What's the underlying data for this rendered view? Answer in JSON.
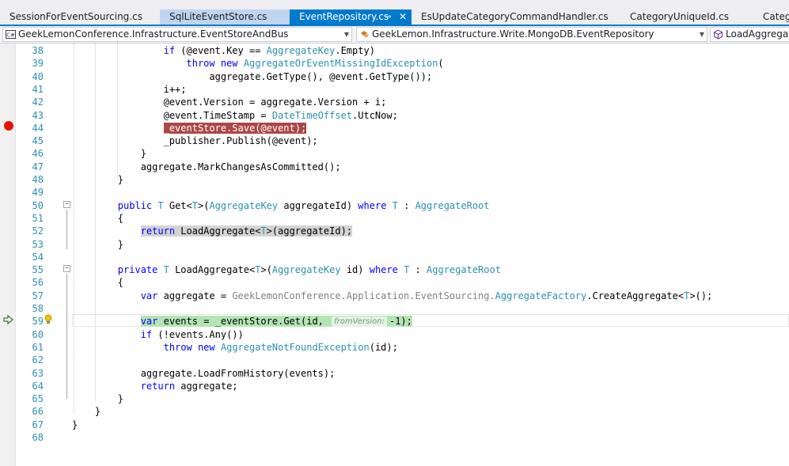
{
  "tabs": [
    {
      "label": "SessionForEventSourcing.cs",
      "state": "inactive"
    },
    {
      "label": "SqlLiteEventStore.cs",
      "state": "highlighted"
    },
    {
      "label": "EventRepository.cs",
      "state": "active",
      "pin": "⊸",
      "close": "✕"
    },
    {
      "label": "EsUpdateCategoryCommandHandler.cs",
      "state": "inactive"
    },
    {
      "label": "CategoryUniqueId.cs",
      "state": "inactive"
    },
    {
      "label": "Catego",
      "state": "inactive"
    }
  ],
  "navbar": {
    "project": "GeekLemonConference.Infrastructure.EventStoreAndBus",
    "class": "GeekLemon.Infrastructure.Write.MongoDB.EventRepository",
    "member": "LoadAggregate",
    "project_icon": "csharp-project-icon",
    "class_icon": "class-icon",
    "member_icon": "method-icon"
  },
  "editor": {
    "param_hint": "fromVersion:",
    "lines": [
      {
        "n": "38",
        "tokens": [
          [
            "                ",
            "plain"
          ],
          [
            "if",
            "kw"
          ],
          [
            " (@event.Key == ",
            "plain"
          ],
          [
            "AggregateKey",
            "type"
          ],
          [
            ".Empty)",
            "plain"
          ]
        ]
      },
      {
        "n": "39",
        "tokens": [
          [
            "                    ",
            "plain"
          ],
          [
            "throw",
            "kw"
          ],
          [
            " ",
            "plain"
          ],
          [
            "new",
            "kw"
          ],
          [
            " ",
            "plain"
          ],
          [
            "AggregateOrEventMissingIdException",
            "type"
          ],
          [
            "(",
            "plain"
          ]
        ]
      },
      {
        "n": "40",
        "tokens": [
          [
            "                        aggregate.GetType(), @event.GetType());",
            "plain"
          ]
        ]
      },
      {
        "n": "41",
        "tokens": [
          [
            "                i++;",
            "plain"
          ]
        ]
      },
      {
        "n": "42",
        "tokens": [
          [
            "                @event.Version = aggregate.Version + i;",
            "plain"
          ]
        ]
      },
      {
        "n": "43",
        "tokens": [
          [
            "                @event.TimeStamp = ",
            "plain"
          ],
          [
            "DateTimeOffset",
            "type"
          ],
          [
            ".UtcNow;",
            "plain"
          ]
        ]
      },
      {
        "n": "44",
        "tokens": [
          [
            "                ",
            "plain"
          ],
          [
            "_eventStore.Save(@event);",
            "bp"
          ]
        ]
      },
      {
        "n": "45",
        "tokens": [
          [
            "                _publisher.Publish(@event);",
            "plain"
          ]
        ]
      },
      {
        "n": "46",
        "tokens": [
          [
            "            }",
            "plain"
          ]
        ]
      },
      {
        "n": "47",
        "tokens": [
          [
            "            aggregate.MarkChangesAsCommitted();",
            "plain"
          ]
        ]
      },
      {
        "n": "48",
        "tokens": [
          [
            "        }",
            "plain"
          ]
        ]
      },
      {
        "n": "49",
        "tokens": []
      },
      {
        "n": "50",
        "tokens": [
          [
            "        ",
            "plain"
          ],
          [
            "public",
            "kw"
          ],
          [
            " ",
            "plain"
          ],
          [
            "T",
            "type"
          ],
          [
            " Get<",
            "plain"
          ],
          [
            "T",
            "type"
          ],
          [
            ">(",
            "plain"
          ],
          [
            "AggregateKey",
            "type"
          ],
          [
            " aggregateId) ",
            "plain"
          ],
          [
            "where",
            "kw"
          ],
          [
            " ",
            "plain"
          ],
          [
            "T",
            "type"
          ],
          [
            " : ",
            "plain"
          ],
          [
            "AggregateRoot",
            "type"
          ]
        ]
      },
      {
        "n": "51",
        "tokens": [
          [
            "        {",
            "plain"
          ]
        ]
      },
      {
        "n": "52",
        "tokens": [
          [
            "            ",
            "plain"
          ],
          [
            "return",
            "kw",
            "gray"
          ],
          [
            " LoadAggregate<",
            "plain",
            "gray"
          ],
          [
            "T",
            "type",
            "gray"
          ],
          [
            ">(aggregateId);",
            "plain",
            "gray"
          ]
        ]
      },
      {
        "n": "53",
        "tokens": [
          [
            "        }",
            "plain"
          ]
        ]
      },
      {
        "n": "54",
        "tokens": []
      },
      {
        "n": "55",
        "tokens": [
          [
            "        ",
            "plain"
          ],
          [
            "private",
            "kw"
          ],
          [
            " ",
            "plain"
          ],
          [
            "T",
            "type"
          ],
          [
            " LoadAggregate<",
            "plain"
          ],
          [
            "T",
            "type"
          ],
          [
            ">(",
            "plain"
          ],
          [
            "AggregateKey",
            "type"
          ],
          [
            " id) ",
            "plain"
          ],
          [
            "where",
            "kw"
          ],
          [
            " ",
            "plain"
          ],
          [
            "T",
            "type"
          ],
          [
            " : ",
            "plain"
          ],
          [
            "AggregateRoot",
            "type"
          ]
        ]
      },
      {
        "n": "56",
        "tokens": [
          [
            "        {",
            "plain"
          ]
        ]
      },
      {
        "n": "57",
        "tokens": [
          [
            "            ",
            "plain"
          ],
          [
            "var",
            "kw"
          ],
          [
            " aggregate = ",
            "plain"
          ],
          [
            "GeekLemonConference.Application.EventSourcing.",
            "gray"
          ],
          [
            "AggregateFactory",
            "type"
          ],
          [
            ".CreateAggregate<",
            "plain"
          ],
          [
            "T",
            "type"
          ],
          [
            ">();",
            "plain"
          ]
        ]
      },
      {
        "n": "58",
        "tokens": []
      },
      {
        "n": "59",
        "tokens": [
          [
            "            ",
            "plain"
          ],
          [
            "var",
            "kw",
            "green"
          ],
          [
            " events = _eventStore.Get(id, ",
            "plain",
            "green"
          ],
          [
            "HINT",
            "hint",
            "green"
          ],
          [
            "-1);",
            "plain",
            "green"
          ]
        ]
      },
      {
        "n": "60",
        "tokens": [
          [
            "            ",
            "plain"
          ],
          [
            "if",
            "kw"
          ],
          [
            " (!events.Any())",
            "plain"
          ]
        ]
      },
      {
        "n": "61",
        "tokens": [
          [
            "                ",
            "plain"
          ],
          [
            "throw",
            "kw"
          ],
          [
            " ",
            "plain"
          ],
          [
            "new",
            "kw"
          ],
          [
            " ",
            "plain"
          ],
          [
            "AggregateNotFoundException",
            "type"
          ],
          [
            "(id);",
            "plain"
          ]
        ]
      },
      {
        "n": "62",
        "tokens": []
      },
      {
        "n": "63",
        "tokens": [
          [
            "            aggregate.LoadFromHistory(events);",
            "plain"
          ]
        ]
      },
      {
        "n": "64",
        "tokens": [
          [
            "            ",
            "plain"
          ],
          [
            "return",
            "kw"
          ],
          [
            " aggregate;",
            "plain"
          ]
        ]
      },
      {
        "n": "65",
        "tokens": [
          [
            "        }",
            "plain"
          ]
        ]
      },
      {
        "n": "66",
        "tokens": [
          [
            "    }",
            "plain"
          ]
        ]
      },
      {
        "n": "67",
        "tokens": [
          [
            "}",
            "plain"
          ]
        ]
      },
      {
        "n": "68",
        "tokens": []
      }
    ]
  },
  "markers": {
    "breakpoint_line": "44",
    "current_line": "59",
    "breakpoint_icon": "breakpoint-icon",
    "instruction_pointer_icon": "instruction-pointer-icon",
    "lightbulb_icon": "lightbulb-icon"
  },
  "colors": {
    "accent": "#007acc",
    "breakpoint": "#e51400",
    "breakpoint_highlight": "#ab4747",
    "current_statement": "#b4e4b4",
    "line_number": "#2b91af",
    "keyword": "#0000ff",
    "type": "#2b91af"
  }
}
